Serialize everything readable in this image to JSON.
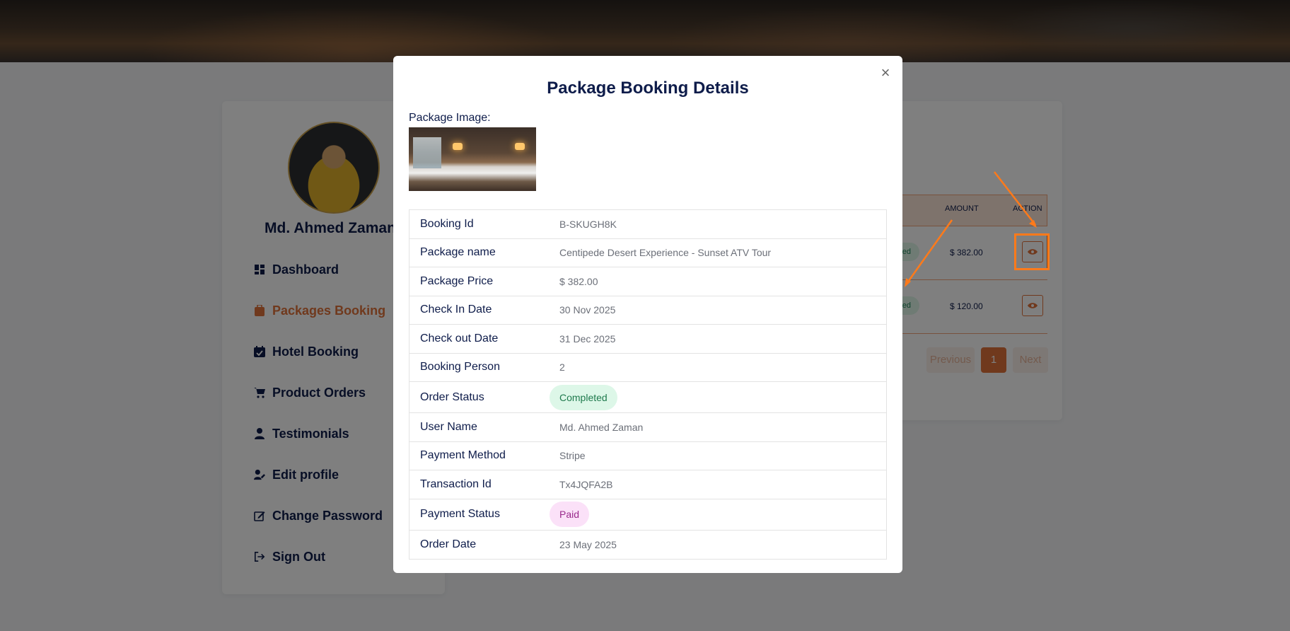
{
  "sidebar": {
    "user_name": "Md. Ahmed Zaman",
    "items": [
      {
        "label": "Dashboard",
        "icon": "dashboard-icon"
      },
      {
        "label": "Packages Booking",
        "icon": "briefcase-icon",
        "active": true
      },
      {
        "label": "Hotel Booking",
        "icon": "calendar-check-icon"
      },
      {
        "label": "Product Orders",
        "icon": "cart-icon"
      },
      {
        "label": "Testimonials",
        "icon": "user-tie-icon"
      },
      {
        "label": "Edit profile",
        "icon": "user-edit-icon"
      },
      {
        "label": "Change Password",
        "icon": "edit-square-icon"
      },
      {
        "label": "Sign Out",
        "icon": "sign-out-icon"
      }
    ]
  },
  "table": {
    "headers": {
      "amount": "AMOUNT",
      "action": "ACTION"
    },
    "rows": [
      {
        "status": "ted",
        "amount": "$ 382.00"
      },
      {
        "status": "ted",
        "amount": "$ 120.00"
      }
    ],
    "pager": {
      "previous": "Previous",
      "page": "1",
      "next": "Next"
    }
  },
  "modal": {
    "title": "Package Booking Details",
    "image_label": "Package Image:",
    "close": "×",
    "fields": [
      {
        "label": "Booking Id",
        "value": "B-SKUGH8K"
      },
      {
        "label": "Package name",
        "value": "Centipede Desert Experience - Sunset ATV Tour"
      },
      {
        "label": "Package Price",
        "value": "$ 382.00"
      },
      {
        "label": "Check In Date",
        "value": "30 Nov 2025"
      },
      {
        "label": "Check out Date",
        "value": "31 Dec 2025"
      },
      {
        "label": "Booking Person",
        "value": "2"
      },
      {
        "label": "Order Status",
        "value": "Completed",
        "badge": "completed"
      },
      {
        "label": "User Name",
        "value": "Md. Ahmed Zaman"
      },
      {
        "label": "Payment Method",
        "value": "Stripe"
      },
      {
        "label": "Transaction Id",
        "value": "Tx4JQFA2B"
      },
      {
        "label": "Payment Status",
        "value": "Paid",
        "badge": "paid"
      },
      {
        "label": "Order Date",
        "value": "23 May 2025"
      }
    ]
  },
  "colors": {
    "accent": "#e0733a",
    "navy": "#0e1c4a",
    "annotation": "#ff7a1a"
  }
}
